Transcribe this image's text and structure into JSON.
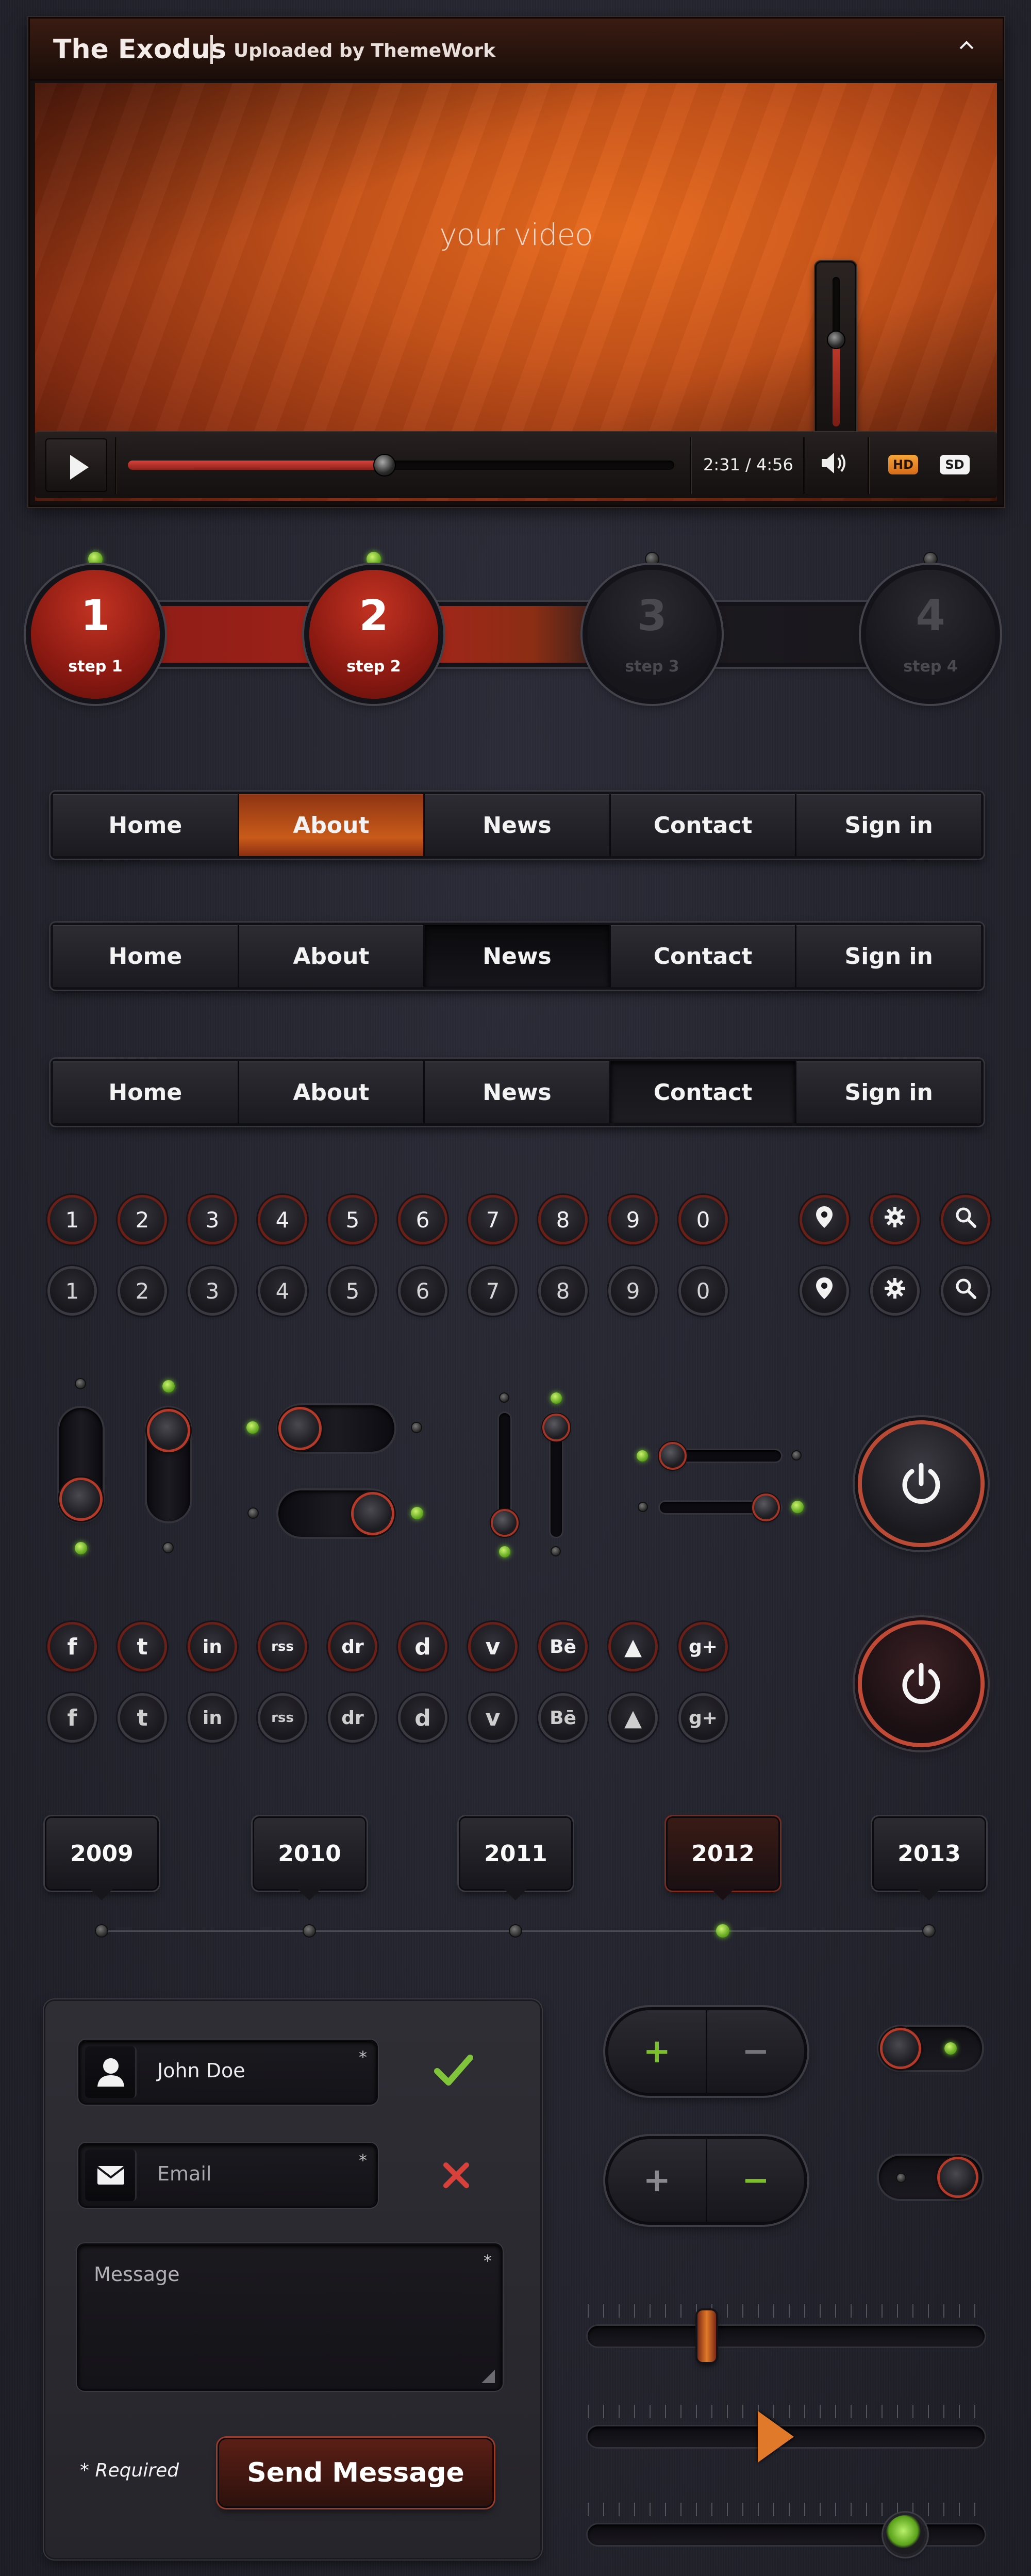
{
  "player": {
    "title": "The Exodus",
    "subtitle": "Uploaded by ThemeWork",
    "video_placeholder": "your video",
    "time": "2:31 / 4:56",
    "progress_fraction": 0.47,
    "volume_fraction": 0.58,
    "hd_label": "HD",
    "sd_label": "SD",
    "collapse_icon": "chevron-up-icon",
    "play_icon": "play-icon",
    "volume_icon": "speaker-icon"
  },
  "steps": [
    {
      "number": "1",
      "label": "step 1",
      "done": true
    },
    {
      "number": "2",
      "label": "step 2",
      "done": true
    },
    {
      "number": "3",
      "label": "step 3",
      "done": false
    },
    {
      "number": "4",
      "label": "step 4",
      "done": false
    }
  ],
  "nav_bars": [
    {
      "items": [
        "Home",
        "About",
        "News",
        "Contact",
        "Sign in"
      ],
      "active": "About"
    },
    {
      "items": [
        "Home",
        "About",
        "News",
        "Contact",
        "Sign in"
      ],
      "active": "News"
    },
    {
      "items": [
        "Home",
        "About",
        "News",
        "Contact",
        "Sign in"
      ],
      "active": "Contact"
    }
  ],
  "number_buttons": [
    "1",
    "2",
    "3",
    "4",
    "5",
    "6",
    "7",
    "8",
    "9",
    "0"
  ],
  "icon_buttons": [
    "map-pin-icon",
    "gear-icon",
    "search-icon"
  ],
  "social_icons": [
    {
      "name": "facebook-icon",
      "glyph": "f"
    },
    {
      "name": "twitter-icon",
      "glyph": "t"
    },
    {
      "name": "linkedin-icon",
      "glyph": "in"
    },
    {
      "name": "rss-icon",
      "glyph": "rss"
    },
    {
      "name": "dribbble-icon",
      "glyph": "dr"
    },
    {
      "name": "digg-icon",
      "glyph": "d"
    },
    {
      "name": "vimeo-icon",
      "glyph": "v"
    },
    {
      "name": "behance-icon",
      "glyph": "Bē"
    },
    {
      "name": "forrst-icon",
      "glyph": "▲"
    },
    {
      "name": "googleplus-icon",
      "glyph": "g+"
    }
  ],
  "timeline": {
    "years": [
      "2009",
      "2010",
      "2011",
      "2012",
      "2013"
    ],
    "active": "2012"
  },
  "form": {
    "name_value": "John Doe",
    "email_placeholder": "Email",
    "message_placeholder": "Message",
    "required_star": "*",
    "required_note": "* Required",
    "send_label": "Send Message",
    "valid_icon": "checkmark-icon",
    "invalid_icon": "cross-icon"
  },
  "steppers": [
    {
      "plus": "+",
      "minus": "−",
      "active": "plus"
    },
    {
      "plus": "+",
      "minus": "−",
      "active": "minus"
    }
  ],
  "range_sliders": [
    {
      "value_fraction": 0.3,
      "handle": "bar"
    },
    {
      "value_fraction": 0.46,
      "handle": "triangle"
    },
    {
      "value_fraction": 0.8,
      "handle": "round"
    }
  ],
  "colors": {
    "accent_orange": "#c95b1a",
    "accent_red": "#a3251a",
    "led_green": "#6cc225",
    "background": "#252530"
  }
}
